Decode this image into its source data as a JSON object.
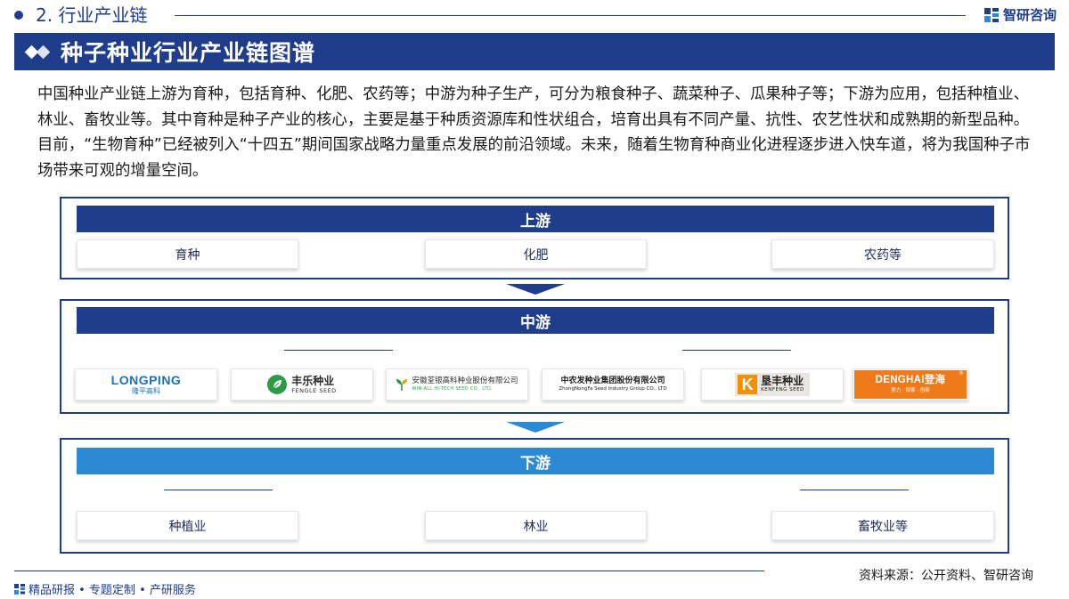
{
  "header": {
    "section_label": "2. 行业产业链",
    "brand_name": "智研咨询",
    "page_title": "种子种业行业产业链图谱"
  },
  "intro_text": "中国种业产业链上游为育种，包括育种、化肥、农药等；中游为种子生产，可分为粮食种子、蔬菜种子、瓜果种子等；下游为应用，包括种植业、林业、畜牧业等。其中育种是种子产业的核心，主要是基于种质资源库和性状组合，培育出具有不同产量、抗性、农艺性状和成熟期的新型品种。目前，“生物育种”已经被列入“十四五”期间国家战略力量重点发展的前沿领域。未来，随着生物育种商业化进程逐步进入快车道，将为我国种子市场带来可观的增量空间。",
  "upstream": {
    "title": "上游",
    "items": [
      "育种",
      "化肥",
      "农药等"
    ]
  },
  "midstream": {
    "title": "中游",
    "logos": {
      "longping": {
        "en": "LONGPING",
        "cn": "隆平高科"
      },
      "fengle": {
        "cn": "丰乐种业",
        "en": "FENGLE SEED"
      },
      "anhui": {
        "cn": "安徽荃银高科种业股份有限公司",
        "en": "WIN-ALL HI-TECH SEED CO., LTD."
      },
      "zhongnong": {
        "cn": "中农发种业集团股份有限公司",
        "en": "ZhongNongFa Seed Industry Group CO., LTD"
      },
      "kenfeng": {
        "mark": "K",
        "cn": "垦丰种业",
        "en": "KENFENG SEED"
      },
      "denghai": {
        "main": "DENGHAI登海",
        "sub": "努力 · 探索 · 创新",
        "reg": "®"
      }
    }
  },
  "downstream": {
    "title": "下游",
    "items": [
      "种植业",
      "林业",
      "畜牧业等"
    ]
  },
  "footer": {
    "source": "资料来源：公开资料、智研咨询",
    "tagline": "精品研报 • 专题定制 • 产研服务"
  },
  "colors": {
    "navy": "#1f3d8a",
    "light_blue": "#2b8ad3",
    "longping_blue": "#1d6fb8",
    "fengle_green": "#2e9b48",
    "kenfeng_orange": "#f29100",
    "denghai_orange": "#ee7a1a"
  }
}
